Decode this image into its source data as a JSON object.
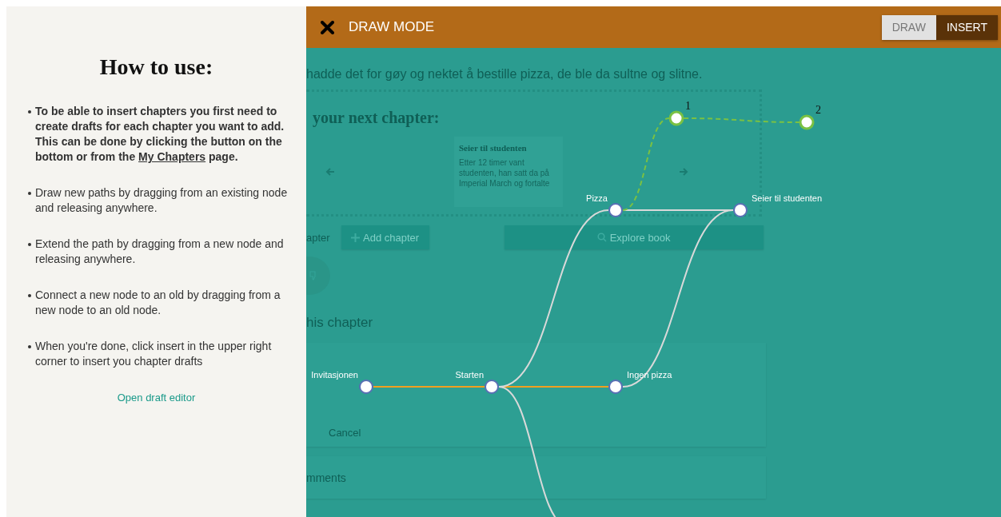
{
  "help_panel": {
    "title": "How to use:",
    "steps": [
      {
        "bold": true,
        "text": "To be able to insert chapters you first need to create drafts for each chapter you want to add. This can be done by clicking the button on the bottom or from the",
        "link": "My Chapters",
        "after": "page."
      },
      {
        "bold": false,
        "text": "Draw new paths by dragging from an existing node and releasing anywhere."
      },
      {
        "bold": false,
        "text": "Extend the path by dragging from a new node and releasing anywhere."
      },
      {
        "bold": false,
        "text": "Connect a new node to an old by dragging from a new node to an old node."
      },
      {
        "bold": false,
        "text": "When you're done, click insert in the upper right corner to insert you chapter drafts"
      }
    ],
    "editor_link": "Open draft editor"
  },
  "toolbar": {
    "title": "DRAW MODE",
    "modes": [
      {
        "label": "DRAW",
        "selected": false
      },
      {
        "label": "INSERT",
        "selected": true
      }
    ]
  },
  "background_page": {
    "story_text": "hadde det for gøy og nektet å bestille pizza, de ble da sultne og slitne.",
    "next_heading": "your next chapter:",
    "suggestion_card": {
      "title": "Seier til studenten",
      "text": "Etter 12 timer vant studenten, han satt da på Imperial March og fortalte"
    },
    "chapter_label": "apter",
    "add_button": "Add chapter",
    "explore_button": "Explore book",
    "section_heading": "his chapter",
    "cancel_button": "Cancel",
    "comments_heading": "mments"
  },
  "graph": {
    "nodes": [
      {
        "label": "Invitasjonen",
        "kind": "chapter"
      },
      {
        "label": "Starten",
        "kind": "chapter"
      },
      {
        "label": "Ingen pizza",
        "kind": "chapter"
      },
      {
        "label": "Pizza",
        "kind": "chapter"
      },
      {
        "label": "Seier til studenten",
        "kind": "chapter"
      },
      {
        "label": "1",
        "kind": "draft"
      },
      {
        "label": "2",
        "kind": "draft"
      }
    ],
    "edges": [
      {
        "kind": "path"
      },
      {
        "kind": "path"
      },
      {
        "kind": "branch"
      },
      {
        "kind": "branch"
      },
      {
        "kind": "branch"
      },
      {
        "kind": "branch"
      },
      {
        "kind": "draft"
      },
      {
        "kind": "draft"
      }
    ]
  }
}
